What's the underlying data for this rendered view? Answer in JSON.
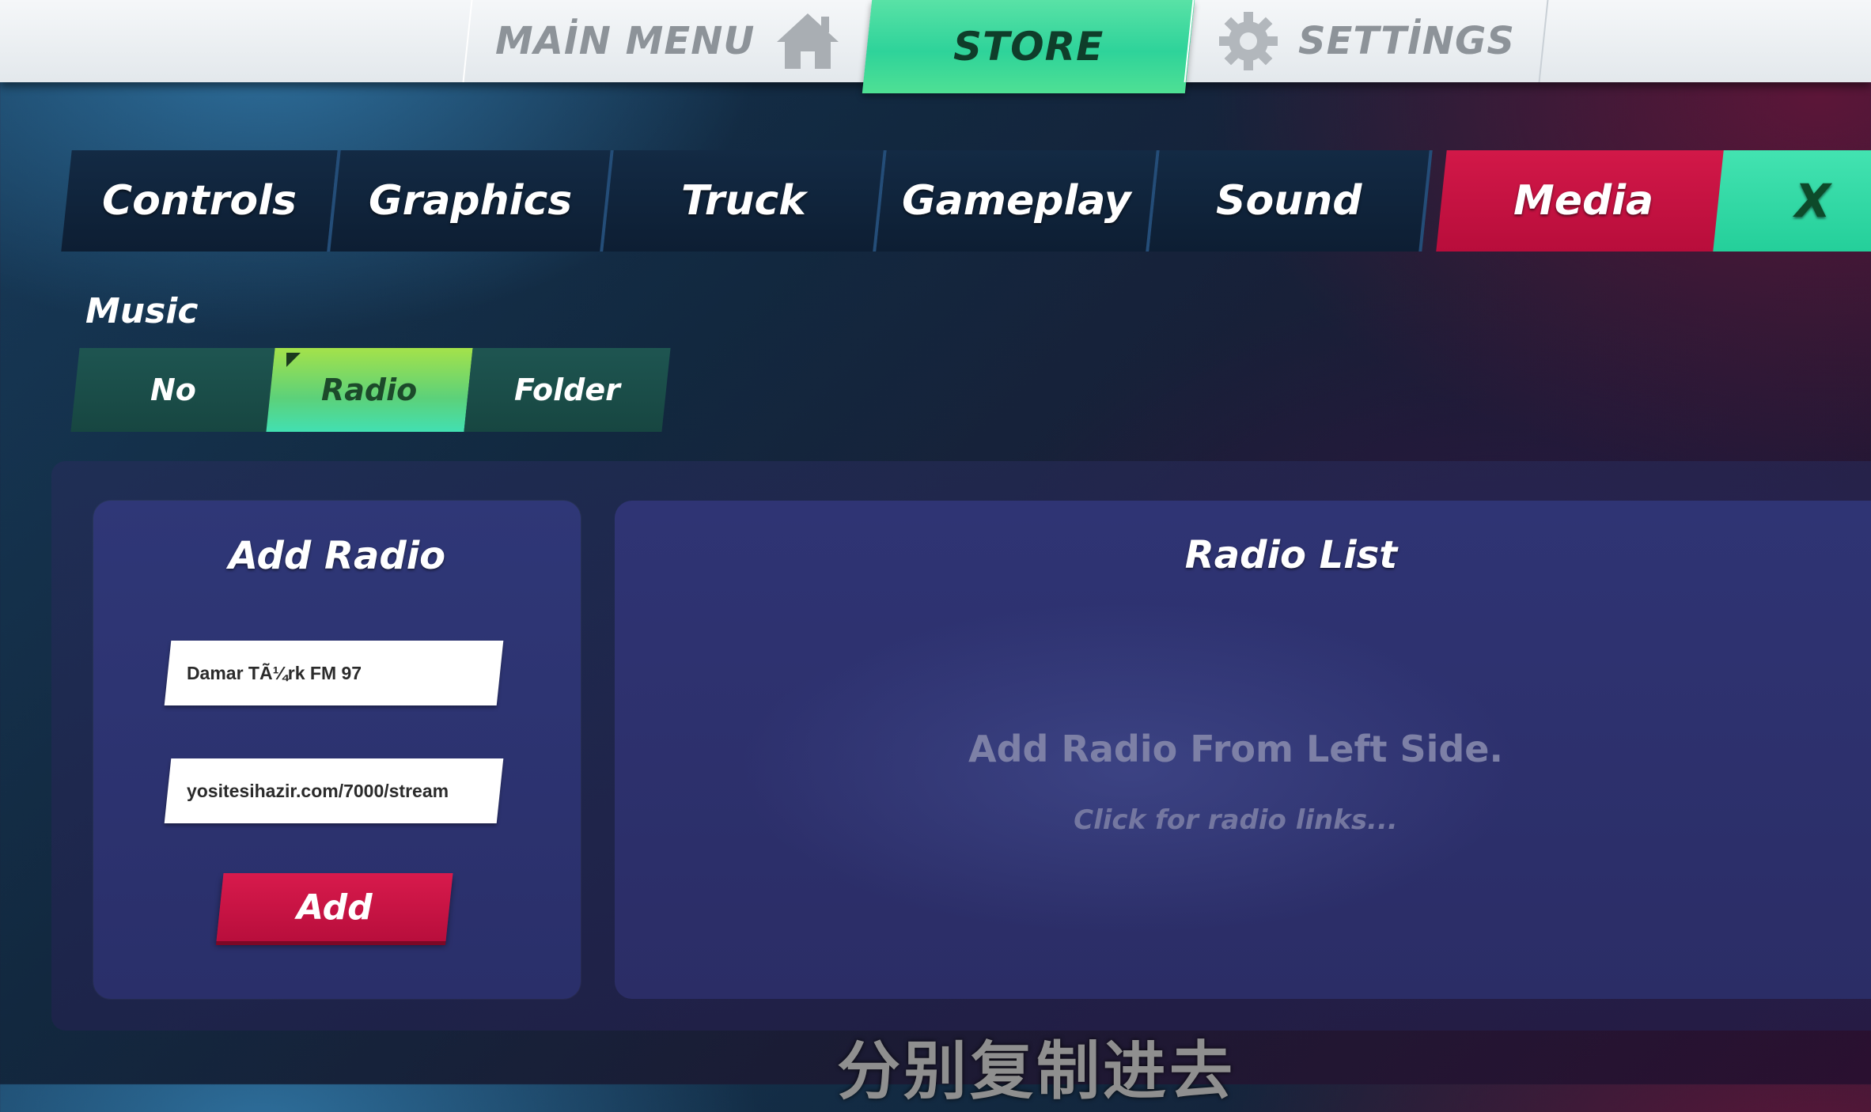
{
  "nav": {
    "main_menu": "MAİN MENU",
    "store": "STORE",
    "settings": "SETTİNGS"
  },
  "tabs": [
    {
      "label": "Controls"
    },
    {
      "label": "Graphics"
    },
    {
      "label": "Truck"
    },
    {
      "label": "Gameplay"
    },
    {
      "label": "Sound"
    },
    {
      "label": "Media",
      "active": true
    },
    {
      "label": "X"
    }
  ],
  "music": {
    "label": "Music",
    "options": [
      "No",
      "Radio",
      "Folder"
    ],
    "selected": "Radio"
  },
  "add_radio": {
    "title": "Add Radio",
    "name_value": "Damar TÃ¼rk FM 97",
    "url_value": "yositesihazir.com/7000/stream",
    "add_button": "Add"
  },
  "radio_list": {
    "title": "Radio List",
    "empty_message": "Add Radio From Left Side.",
    "link_hint": "Click for radio links..."
  },
  "subtitle": "分别复制进去",
  "colors": {
    "accent_green": "#2ed39a",
    "accent_red": "#c8123f",
    "tab_bg": "#0f2239",
    "panel_bg": "#2d3370"
  },
  "icons": [
    "home-icon",
    "gear-icon"
  ]
}
